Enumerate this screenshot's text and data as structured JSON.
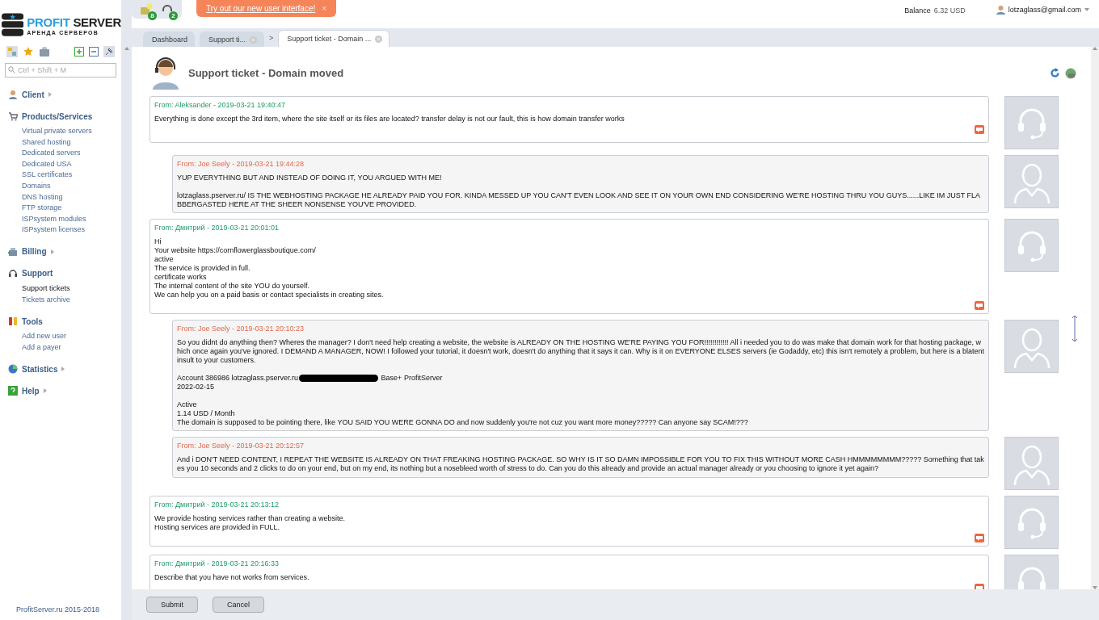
{
  "logo": {
    "name_first": "PROFIT",
    "name_second": "SERVER",
    "tagline": "АРЕНДА СЕРВЕРОВ"
  },
  "sidebar": {
    "search": {
      "placeholder": "Ctrl + Shift + M"
    },
    "groups": [
      {
        "kind": "client",
        "title": "Client",
        "expanded": false
      },
      {
        "kind": "cart",
        "title": "Products/Services",
        "expanded": true,
        "items": [
          {
            "label": "Virtual private servers",
            "selected": false
          },
          {
            "label": "Shared hosting",
            "selected": false
          },
          {
            "label": "Dedicated servers",
            "selected": false
          },
          {
            "label": "Dedicated USA",
            "selected": false
          },
          {
            "label": "SSL certificates",
            "selected": false
          },
          {
            "label": "Domains",
            "selected": false
          },
          {
            "label": "DNS hosting",
            "selected": false
          },
          {
            "label": "FTP storage",
            "selected": false
          },
          {
            "label": "ISPsystem modules",
            "selected": false
          },
          {
            "label": "ISPsystem licenses",
            "selected": false
          }
        ]
      },
      {
        "kind": "billing",
        "title": "Billing",
        "expanded": false
      },
      {
        "kind": "support",
        "title": "Support",
        "expanded": true,
        "items": [
          {
            "label": "Support tickets",
            "selected": true
          },
          {
            "label": "Tickets archive",
            "selected": false
          }
        ]
      },
      {
        "kind": "tools",
        "title": "Tools",
        "expanded": true,
        "items": [
          {
            "label": "Add new user",
            "selected": false
          },
          {
            "label": "Add a payer",
            "selected": false
          }
        ]
      },
      {
        "kind": "stats",
        "title": "Statistics",
        "expanded": false
      },
      {
        "kind": "help",
        "title": "Help",
        "expanded": false
      }
    ],
    "footer": "ProfitServer.ru 2015-2018"
  },
  "notifications": [
    {
      "kind": "mail",
      "count": "8"
    },
    {
      "kind": "support",
      "count": "2"
    }
  ],
  "banner": {
    "link": "Try out our new user interface!",
    "close": "×"
  },
  "balance": {
    "label": "Balance",
    "amount": "6.32 USD"
  },
  "user": {
    "email": "lotzaglass@gmail.com"
  },
  "tabs": [
    {
      "label": "Dashboard",
      "selected": false,
      "closable": false
    },
    {
      "label": "Support ti...",
      "selected": false,
      "closable": true
    },
    {
      "label": "Support ticket - Domain ...",
      "selected": true,
      "closable": true,
      "separator": ">"
    }
  ],
  "page": {
    "title": "Support ticket - Domain moved"
  },
  "messages": [
    {
      "kind": "staff",
      "from": "From: Aleksander - 2019-03-21 19:40:47",
      "paragraphs": [
        [
          "Everything is done except the 3rd item, where the site itself or its files are located? transfer delay is not our fault, this is how domain transfer works"
        ]
      ]
    },
    {
      "kind": "client",
      "from": "From: Joe Seely - 2019-03-21 19:44:28",
      "paragraphs": [
        [
          "YUP EVERYTHING BUT AND INSTEAD OF DOING IT, YOU ARGUED WITH ME!"
        ],
        [
          "lotzaglass.pserver.ru/ IS THE WEBHOSTING PACKAGE HE ALREADY PAID YOU FOR. KINDA MESSED UP YOU CAN'T EVEN LOOK AND SEE IT ON YOUR OWN END CONSIDERING WE'RE HOSTING THRU YOU GUYS......LIKE IM JUST FLABBERGASTED HERE AT THE SHEER NONSENSE YOU'VE PROVIDED."
        ]
      ]
    },
    {
      "kind": "staff",
      "from": "From: Дмитрий - 2019-03-21 20:01:01",
      "paragraphs": [
        [
          "Hi",
          "Your website https://cornflowerglassboutique.com/",
          "active",
          "The service is provided in full.",
          "certificate works",
          "The internal content of the site YOU do yourself.",
          "We can help you on a paid basis or contact specialists in creating sites."
        ]
      ]
    },
    {
      "kind": "client",
      "from": "From: Joe Seely - 2019-03-21 20:10:23",
      "paragraphs": [
        [
          "So you didnt do anything then? Wheres the manager? I don't need help creating a website, the website is ALREADY ON THE HOSTING WE'RE PAYING YOU FOR!!!!!!!!!!!! All i needed you to do was make that domain work for that hosting package, which once again you've ignored. I DEMAND A MANAGER, NOW! I followed your tutorial, it doesn't work, doesn't do anything that it says it can. Why is it on EVERYONE ELSES servers (ie Godaddy, etc) this isn't remotely a problem, but here is a blatent insult to your customers."
        ],
        [
          [
            "Account 386986 lotzaglass.pserver.ru",
            "Base+ ProfitServer"
          ],
          "2022-02-15"
        ],
        [
          "Active",
          "1.14 USD / Month",
          "The domain is supposed to be pointing there, like YOU SAID YOU WERE GONNA DO and now suddenly you're not cuz you want more money????? Can anyone say SCAM!???"
        ]
      ]
    },
    {
      "kind": "client",
      "from": "From: Joe Seely - 2019-03-21 20:12:57",
      "paragraphs": [
        [
          "And i DON'T NEED CONTENT, I REPEAT THE WEBSITE IS ALREADY ON THAT FREAKING HOSTING PACKAGE. SO WHY IS IT SO DAMN IMPOSSIBLE FOR YOU TO FIX THIS WITHOUT MORE CASH HMMMMMMMM????? Something that takes you 10 seconds and 2 clicks to do on your end, but on my end, its nothing but a nosebleed worth of stress to do. Can you do this already and provide an actual manager already or you choosing to ignore it yet again?"
        ]
      ]
    },
    {
      "kind": "staff",
      "from": "From: Дмитрий - 2019-03-21 20:13:12",
      "paragraphs": [
        [
          "We provide hosting services rather than creating a website.",
          "Hosting services are provided in FULL."
        ]
      ]
    },
    {
      "kind": "staff",
      "from": "From: Дмитрий - 2019-03-21 20:16:33",
      "paragraphs": [
        [
          "Describe that you have not works from services."
        ]
      ]
    }
  ],
  "buttons": [
    "Submit",
    "Cancel"
  ]
}
